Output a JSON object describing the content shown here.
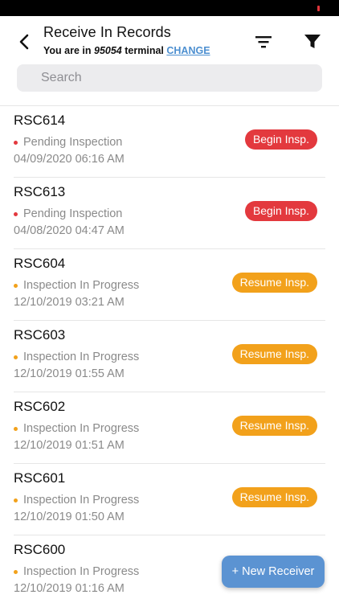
{
  "header": {
    "title": "Receive In Records",
    "subtitle_prefix": "You are in",
    "terminal_id": "95054",
    "subtitle_mid": "terminal",
    "change_label": "CHANGE",
    "back_icon": "chevron-left-icon",
    "sort_icon": "sort-lines-icon",
    "filter_icon": "funnel-icon"
  },
  "search": {
    "placeholder": "Search",
    "value": ""
  },
  "colors": {
    "pending": "#e3393e",
    "in_progress": "#f2a11b",
    "accent": "#5b93d2"
  },
  "records": [
    {
      "code": "RSC614",
      "status": "Pending Inspection",
      "state": "pending",
      "date": "04/09/2020 06:16 AM",
      "action": "Begin Insp."
    },
    {
      "code": "RSC613",
      "status": "Pending Inspection",
      "state": "pending",
      "date": "04/08/2020 04:47 AM",
      "action": "Begin Insp."
    },
    {
      "code": "RSC604",
      "status": "Inspection In Progress",
      "state": "in_progress",
      "date": "12/10/2019 03:21 AM",
      "action": "Resume Insp."
    },
    {
      "code": "RSC603",
      "status": "Inspection In Progress",
      "state": "in_progress",
      "date": "12/10/2019 01:55 AM",
      "action": "Resume Insp."
    },
    {
      "code": "RSC602",
      "status": "Inspection In Progress",
      "state": "in_progress",
      "date": "12/10/2019 01:51 AM",
      "action": "Resume Insp."
    },
    {
      "code": "RSC601",
      "status": "Inspection In Progress",
      "state": "in_progress",
      "date": "12/10/2019 01:50 AM",
      "action": "Resume Insp."
    },
    {
      "code": "RSC600",
      "status": "Inspection In Progress",
      "state": "in_progress",
      "date": "12/10/2019 01:16 AM",
      "action": ""
    }
  ],
  "fab": {
    "label": "+ New Receiver"
  }
}
